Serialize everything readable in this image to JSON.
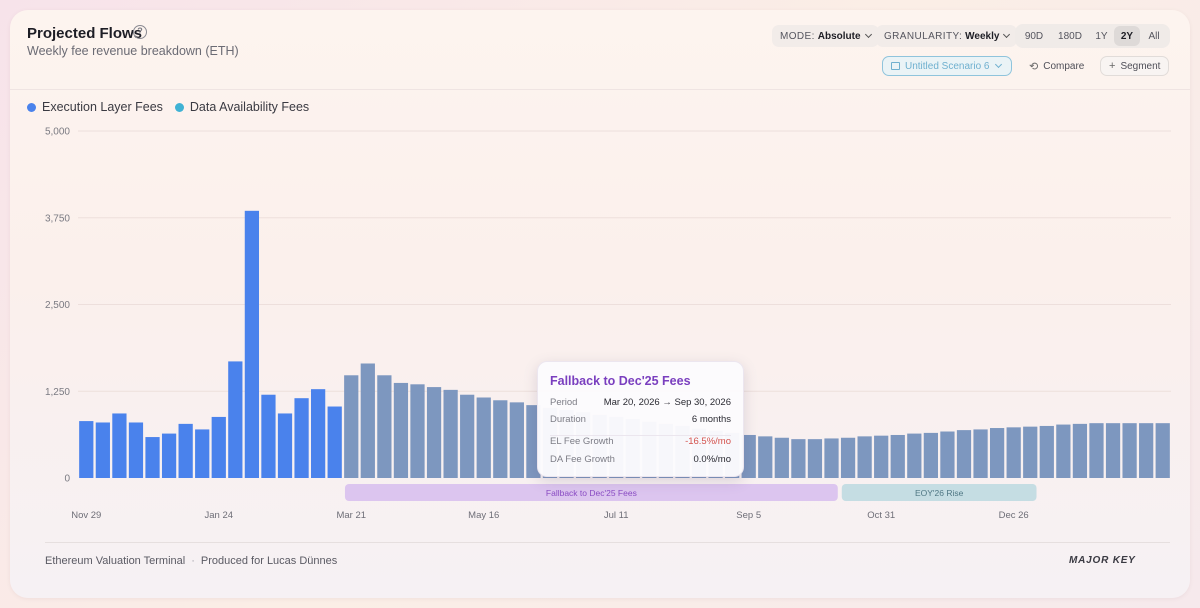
{
  "header": {
    "title": "Projected Flows",
    "subtitle": "Weekly fee revenue breakdown (ETH)",
    "help_icon": "?"
  },
  "controls": {
    "mode_label": "MODE:",
    "mode_value": "Absolute",
    "granularity_label": "GRANULARITY:",
    "granularity_value": "Weekly",
    "ranges": [
      "90D",
      "180D",
      "1Y",
      "2Y",
      "All"
    ],
    "active_range": "2Y",
    "scenario_label": "Untitled Scenario 6",
    "compare_label": "Compare",
    "segment_label": "Segment"
  },
  "colors": {
    "execution": "#4a82ec",
    "projected": "#7d97bf",
    "data_availability": "#3fb2d4",
    "segment_fallback": "#dcc5ef",
    "segment_fallback_text": "#8a4bc4",
    "segment_eoy": "#c5dde3",
    "segment_eoy_text": "#4f7784"
  },
  "chart_data": {
    "type": "bar",
    "series": [
      {
        "name": "Execution Layer Fees",
        "actual_count": 16,
        "values": [
          820,
          800,
          930,
          800,
          590,
          640,
          780,
          700,
          880,
          1680,
          3850,
          1200,
          930,
          1150,
          1280,
          1030,
          1480,
          1650,
          1480,
          1370,
          1350,
          1310,
          1270,
          1200,
          1160,
          1120,
          1090,
          1050,
          1010,
          980,
          950,
          910,
          880,
          850,
          810,
          780,
          750,
          710,
          680,
          650,
          620,
          600,
          580,
          560,
          560,
          570,
          580,
          600,
          610,
          620,
          640,
          650,
          670,
          690,
          700,
          720,
          730,
          740,
          750,
          770,
          780,
          790,
          790,
          790,
          790,
          790
        ]
      },
      {
        "name": "Data Availability Fees",
        "values": []
      }
    ],
    "ylim": [
      0,
      5000
    ],
    "yticks": [
      "5,000",
      "3,750",
      "2,500",
      "1,250",
      "0"
    ],
    "ytick_values": [
      5000,
      3750,
      2500,
      1250,
      0
    ],
    "xticks": [
      {
        "label": "Nov 29",
        "index": 0
      },
      {
        "label": "Jan 24",
        "index": 8
      },
      {
        "label": "Mar 21",
        "index": 16
      },
      {
        "label": "May 16",
        "index": 24
      },
      {
        "label": "Jul 11",
        "index": 32
      },
      {
        "label": "Sep 5",
        "index": 40
      },
      {
        "label": "Oct 31",
        "index": 48
      },
      {
        "label": "Dec 26",
        "index": 56
      }
    ],
    "segments": [
      {
        "label": "Fallback to Dec'25 Fees",
        "start_index": 16,
        "end_index": 45,
        "style": "fallback"
      },
      {
        "label": "EOY'26 Rise",
        "start_index": 46,
        "end_index": 57,
        "style": "eoy"
      }
    ],
    "legend_position": "top-left",
    "grid": true
  },
  "tooltip": {
    "title": "Fallback to Dec'25 Fees",
    "rows": [
      {
        "key": "Period",
        "value": "Mar 20, 2026 → Sep 30, 2026"
      },
      {
        "key": "Duration",
        "value": "6 months"
      },
      {
        "key": "EL Fee Growth",
        "value": "-16.5%/mo"
      },
      {
        "key": "DA Fee Growth",
        "value": "0.0%/mo"
      }
    ]
  },
  "footer": {
    "left_a": "Ethereum Valuation Terminal",
    "separator": "·",
    "left_b": "Produced for Lucas Dünnes",
    "brand": "MAJOR KEY"
  }
}
